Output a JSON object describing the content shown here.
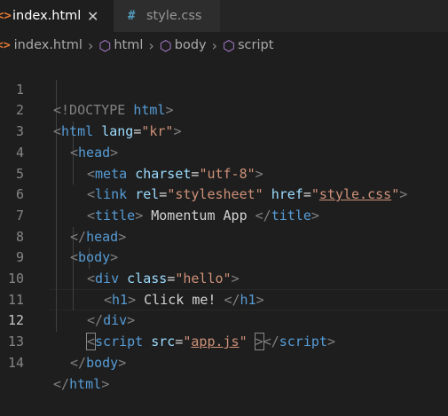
{
  "tabs": [
    {
      "label": "index.html",
      "icon": "<>",
      "close": "✕"
    },
    {
      "label": "style.css",
      "icon": "#"
    }
  ],
  "breadcrumbs": {
    "items": [
      "index.html",
      "html",
      "body",
      "script"
    ],
    "separator": "›"
  },
  "editor": {
    "active_line": 12,
    "lines": [
      {
        "n": "1",
        "tokens": [
          "<!DOCTYPE",
          " ",
          "html",
          ">"
        ]
      },
      {
        "n": "2",
        "tokens": [
          "<",
          "html",
          " ",
          "lang",
          "=",
          "\"kr\"",
          ">"
        ]
      },
      {
        "n": "3",
        "tokens": [
          "<",
          "head",
          ">"
        ]
      },
      {
        "n": "4",
        "tokens": [
          "<",
          "meta",
          " ",
          "charset",
          "=",
          "\"utf-8\"",
          ">"
        ]
      },
      {
        "n": "5",
        "tokens": [
          "<",
          "link",
          " ",
          "rel",
          "=",
          "\"stylesheet\"",
          " ",
          "href",
          "=",
          "\"",
          "style.css",
          "\"",
          ">"
        ]
      },
      {
        "n": "6",
        "tokens": [
          "<",
          "title",
          ">",
          " Momentum App ",
          "</",
          "title",
          ">"
        ]
      },
      {
        "n": "7",
        "tokens": [
          "</",
          "head",
          ">"
        ]
      },
      {
        "n": "8",
        "tokens": [
          "<",
          "body",
          ">"
        ]
      },
      {
        "n": "9",
        "tokens": [
          "<",
          "div",
          " ",
          "class",
          "=",
          "\"hello\"",
          ">"
        ]
      },
      {
        "n": "10",
        "tokens": [
          "<",
          "h1",
          ">",
          " Click me! ",
          "</",
          "h1",
          ">"
        ]
      },
      {
        "n": "11",
        "tokens": [
          "</",
          "div",
          ">"
        ]
      },
      {
        "n": "12",
        "tokens": [
          "<",
          "script",
          " ",
          "src",
          "=",
          "\"",
          "app.js",
          "\"",
          " ",
          ">",
          "</",
          "script",
          ">"
        ]
      },
      {
        "n": "13",
        "tokens": [
          "</",
          "body",
          ">"
        ]
      },
      {
        "n": "14",
        "tokens": [
          "</",
          "html",
          ">"
        ]
      }
    ]
  },
  "colors": {
    "background": "#1e1e1e",
    "tag_bracket": "#808080",
    "tag_name": "#569cd6",
    "attribute": "#9cdcfe",
    "string": "#ce9178",
    "text": "#d4d4d4",
    "html_icon": "#e37933",
    "css_icon": "#519aba",
    "symbol_icon": "#b180d7"
  },
  "icons": {
    "html_file": "html-file-icon",
    "css_file": "css-file-icon",
    "symbol": "cube-symbol-icon",
    "close": "close-icon"
  }
}
